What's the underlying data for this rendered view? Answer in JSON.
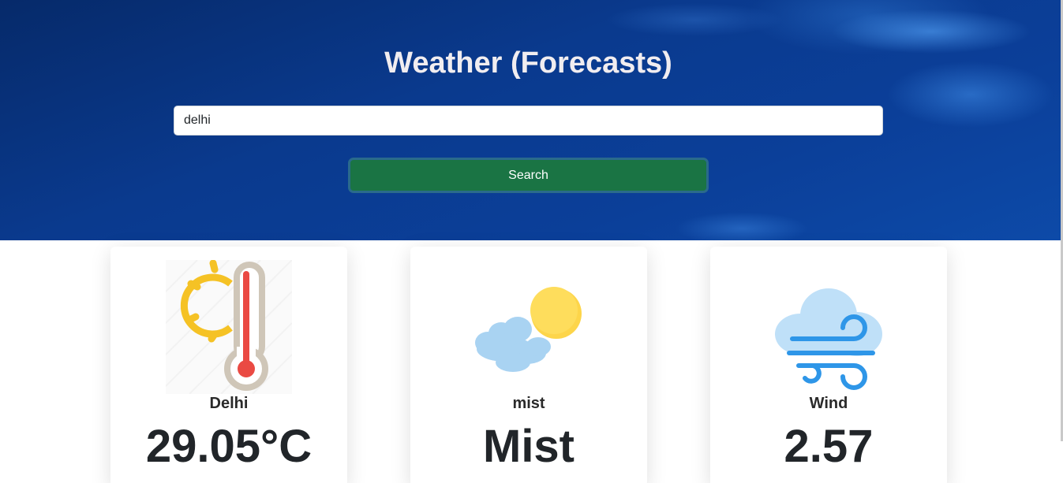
{
  "header": {
    "title": "Weather (Forecasts)"
  },
  "search": {
    "value": "delhi",
    "button_label": "Search"
  },
  "cards": [
    {
      "icon": "thermometer-sun-icon",
      "label": "Delhi",
      "value": "29.05°C"
    },
    {
      "icon": "cloud-sun-icon",
      "label": "mist",
      "value": "Mist"
    },
    {
      "icon": "cloud-wind-icon",
      "label": "Wind",
      "value": "2.57"
    }
  ],
  "colors": {
    "hero": "#0b3f99",
    "button": "#1a7444",
    "title": "#f1edf0"
  }
}
